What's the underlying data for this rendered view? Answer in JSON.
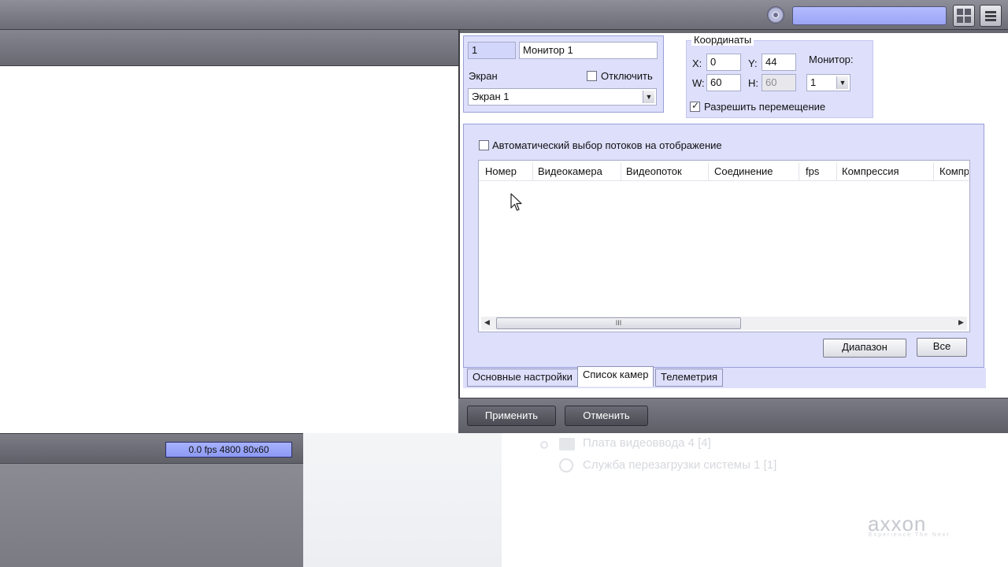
{
  "monitor": {
    "id": "1",
    "name": "Монитор 1",
    "screen_label": "Экран",
    "disable_label": "Отключить",
    "disable_checked": false,
    "screen_value": "Экран 1"
  },
  "coordinates": {
    "legend": "Координаты",
    "x_label": "X:",
    "x_value": "0",
    "y_label": "Y:",
    "y_value": "44",
    "w_label": "W:",
    "w_value": "60",
    "h_label": "H:",
    "h_value": "60",
    "monitor_label": "Монитор:",
    "monitor_value": "1",
    "allow_move_label": "Разрешить перемещение",
    "allow_move_checked": true
  },
  "camera_list": {
    "auto_select_label": "Автоматический выбор потоков на отображение",
    "auto_select_checked": false,
    "columns": [
      "Номер",
      "Видеокамера",
      "Видеопоток",
      "Соединение",
      "fps",
      "Компрессия",
      "Компр"
    ],
    "rows": [],
    "range_button": "Диапазон",
    "all_button": "Все",
    "scroll_thumb_glyph": "III"
  },
  "tabs": [
    {
      "label": "Основные настройки",
      "active": false
    },
    {
      "label": "Список камер",
      "active": true
    },
    {
      "label": "Телеметрия",
      "active": false
    }
  ],
  "footer": {
    "apply_button": "Применить",
    "cancel_button": "Отменить"
  },
  "video_status": {
    "fps_text": "0.0 fps   4800 80x60"
  },
  "background_tree": {
    "items": [
      "Плата видеоввода 4 [4]",
      "Служба перезагрузки системы 1 [1]"
    ]
  },
  "branding": {
    "logo_text": "axxon",
    "tagline": "Experience The Next"
  },
  "colors": {
    "panel_bg": "#dddffb",
    "accent_blue": "#9aa4f5",
    "dark_bar": "#686971"
  }
}
